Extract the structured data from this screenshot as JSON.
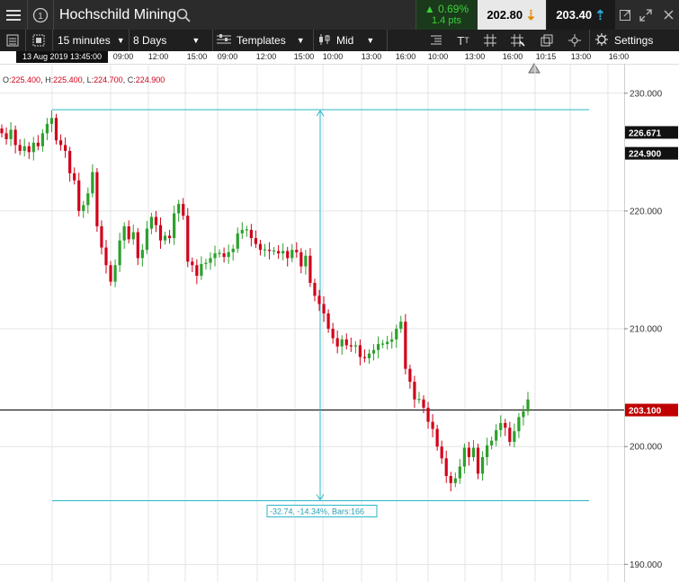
{
  "header": {
    "instrument": "Hochschild Mining",
    "change_pct": "0.69%",
    "change_pts": "1.4 pts",
    "sell_price": "202.80",
    "buy_price": "203.40"
  },
  "toolbar": {
    "interval": "15 minutes",
    "period": "8 Days",
    "templates": "Templates",
    "price_type": "Mid",
    "settings": "Settings"
  },
  "time_axis": {
    "cursor_label": "13 Aug 2019 13:45:00",
    "ticks": [
      "09:00",
      "12:00",
      "15:00",
      "09:00",
      "12:00",
      "15:00",
      "10:00",
      "13:00",
      "16:00",
      "10:00",
      "13:00",
      "16:00",
      "10:15",
      "13:00",
      "16:00"
    ]
  },
  "ohlc": {
    "o_label": "O:",
    "o": "225.400",
    "h_label": "H:",
    "h": "225.400",
    "l_label": "L:",
    "l": "224.700",
    "c_label": "C:",
    "c": "224.900"
  },
  "measure_label": "-32.74, -14.34%, Bars:166",
  "price_axis": {
    "ticks": [
      "230.000",
      "220.000",
      "210.000",
      "200.000",
      "190.000"
    ],
    "marker_top": "226.671",
    "marker_cursor": "224.900",
    "marker_last": "203.100"
  },
  "chart_data": {
    "type": "candlestick",
    "y_range": [
      188.5,
      232.5
    ],
    "price_ticks": [
      230,
      220,
      210,
      200,
      190
    ],
    "measure": {
      "top": 228.6,
      "bottom": 195.4
    },
    "last_price": 203.1,
    "cursor_price": 224.9,
    "up_color": "#2ca02c",
    "down_color": "#d0021b",
    "closes": [
      226.6,
      226.1,
      226.9,
      225.6,
      225.1,
      225.5,
      225.0,
      225.8,
      225.5,
      226.6,
      227.4,
      227.9,
      226.0,
      225.6,
      225.1,
      223.2,
      222.6,
      220.0,
      220.5,
      221.5,
      223.3,
      218.7,
      216.9,
      215.4,
      214.0,
      215.4,
      217.5,
      218.7,
      217.6,
      218.2,
      216.0,
      216.7,
      218.5,
      219.5,
      218.8,
      217.5,
      217.9,
      217.7,
      219.8,
      220.6,
      219.6,
      215.7,
      215.4,
      214.5,
      215.5,
      215.6,
      216.0,
      216.4,
      216.4,
      216.1,
      216.5,
      216.8,
      218.1,
      218.4,
      218.4,
      217.7,
      217.2,
      216.7,
      216.7,
      216.6,
      216.6,
      216.4,
      216.6,
      216.0,
      216.7,
      216.5,
      215.3,
      216.2,
      213.9,
      212.8,
      212.1,
      211.3,
      210.0,
      209.2,
      208.5,
      209.1,
      208.6,
      208.5,
      208.6,
      207.6,
      207.5,
      207.9,
      208.2,
      208.7,
      208.7,
      208.9,
      209.1,
      210.0,
      210.6,
      206.6,
      205.5,
      204.0,
      204.0,
      203.3,
      202.1,
      201.5,
      200.0,
      199.0,
      197.5,
      196.9,
      197.3,
      198.3,
      199.9,
      199.1,
      199.9,
      197.7,
      199.1,
      200.1,
      200.5,
      201.4,
      202.0,
      201.6,
      200.4,
      201.3,
      202.5,
      203.0,
      204.0
    ]
  }
}
